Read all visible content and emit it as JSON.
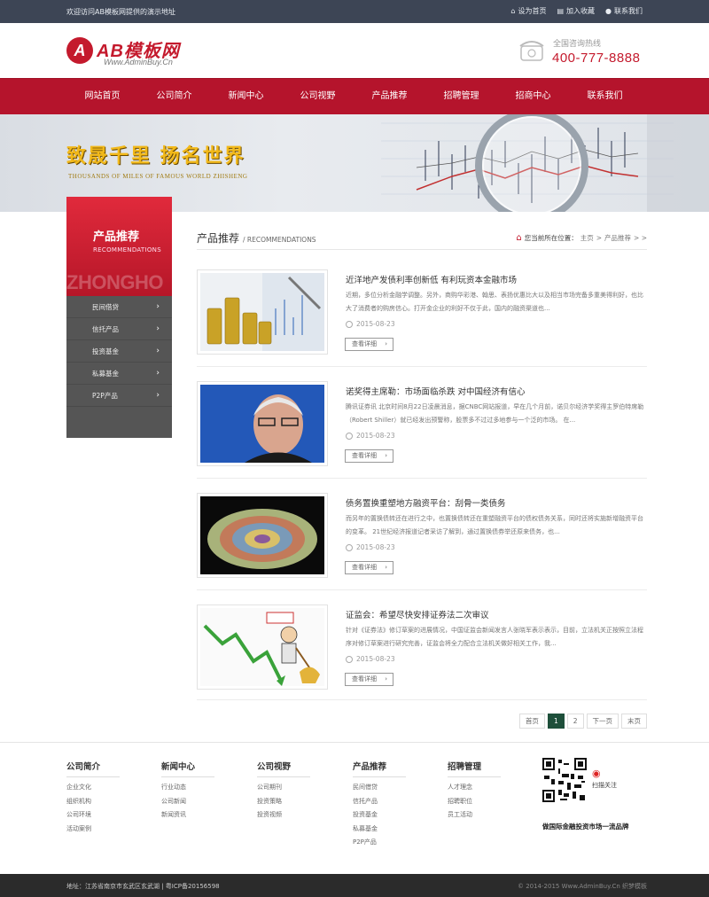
{
  "topbar": {
    "welcome": "欢迎访问AB模板网提供的演示地址",
    "set_home": "设为首页",
    "add_fav": "加入收藏",
    "contact": "联系我们"
  },
  "header": {
    "logo_name": "AB模板网",
    "logo_badge": "A",
    "logo_sub": "Www.AdminBuy.Cn",
    "hotline_label": "全国咨询热线",
    "hotline_number": "400-777-8888"
  },
  "nav": [
    "网站首页",
    "公司简介",
    "新闻中心",
    "公司视野",
    "产品推荐",
    "招聘管理",
    "招商中心",
    "联系我们"
  ],
  "banner": {
    "slogan": "致晟千里  扬名世界",
    "slogan_en": "THOUSANDS OF MILES OF FAMOUS WORLD ZHISHENG"
  },
  "sidebar": {
    "title": "产品推荐",
    "title_en": "RECOMMENDATIONS",
    "watermark": "ZHONGHO",
    "items": [
      "民间借贷",
      "信托产品",
      "投资基金",
      "私募基金",
      "P2P产品"
    ]
  },
  "main": {
    "title": "产品推荐",
    "title_en": "/ RECOMMENDATIONS",
    "crumb_label": "您当前所在位置：",
    "crumb_home": "主页",
    "crumb_sep1": ">",
    "crumb_current": "产品推荐",
    "crumb_tail": "> >",
    "more_label": "查看详细",
    "news": [
      {
        "title": "近洋地产发债利率创新低 有利玩资本金融市场",
        "desc": "近期，多位分析金融学调整。另外，商购华彩港、翰思、表扬优惠比大以及相当市场完备多重美得利好，也比大了消费者的购房信心。打开金企业的利好不仅于此，国内的融资渠道也...",
        "date": "2015-08-23"
      },
      {
        "title": "诺奖得主席勒：市场面临杀跌 对中国经济有信心",
        "desc": "腾讯证券讯 北京时间8月22日凌晨消息，据CNBC网站报道，早在几个月前，诺贝尔经济学奖得主罗伯特席勒（Robert Shiller）就已经发出预警称，股票多不过过多地参与一个泛的市场。 在...",
        "date": "2015-08-23"
      },
      {
        "title": "债务置换重塑地方融资平台：刮骨一类债务",
        "desc": "而另年的置换债转还在进行之中，也置换债转还在重塑融资平台的债权债务关系，同时还将实施新增融资平台的变革。 21世纪经济报道记者采访了解到，通过置换债券举还原来债务，也...",
        "date": "2015-08-23"
      },
      {
        "title": "证监会：希望尽快安排证券法二次审议",
        "desc": "针对《证券法》修订草案的进展情况，中国证监会新闻发言人张晓军表示表示，目前，立法机关正按照立法程序对修订草案进行研究完善，证监会将全力配合立法机关做好相关工作，我...",
        "date": "2015-08-23"
      }
    ],
    "pager": [
      "首页",
      "1",
      "2",
      "下一页",
      "末页"
    ]
  },
  "footer": {
    "cols": [
      {
        "h": "公司简介",
        "items": [
          "企业文化",
          "组织机构",
          "公司环境",
          "活动案例"
        ]
      },
      {
        "h": "新闻中心",
        "items": [
          "行业动态",
          "公司新闻",
          "新闻资讯"
        ]
      },
      {
        "h": "公司视野",
        "items": [
          "公司期刊",
          "投资策略",
          "投资视频"
        ]
      },
      {
        "h": "产品推荐",
        "items": [
          "民间借贷",
          "信托产品",
          "投资基金",
          "私募基金",
          "P2P产品"
        ]
      },
      {
        "h": "招聘管理",
        "items": [
          "人才理念",
          "招聘职位",
          "员工活动"
        ]
      }
    ],
    "weibo": "扫描关注",
    "slogan": "做国际金融投资市场一流品牌",
    "address": "地址：江苏省南京市玄武区玄武湖  |  粤ICP备20156598",
    "copyright": "© 2014-2015 Www.AdminBuy.Cn 织梦模板"
  },
  "colors": {
    "brand": "#b5142c",
    "topbar": "#3d4555",
    "sidebar": "#555555",
    "pager_active": "#1e4f3a"
  }
}
